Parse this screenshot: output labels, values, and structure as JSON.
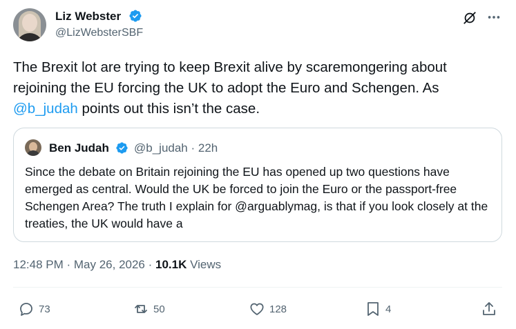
{
  "author": {
    "name": "Liz Webster",
    "handle": "@LizWebsterSBF"
  },
  "tweet": {
    "text_before": "The Brexit lot are trying to keep Brexit alive by scaremongering about rejoining the EU forcing the UK to adopt the Euro and Schengen. As ",
    "mention": "@b_judah",
    "text_after": " points out this isn’t the case."
  },
  "quoted": {
    "name": "Ben Judah",
    "meta": "@b_judah · 22h",
    "text": "Since the debate on Britain rejoining the EU has opened up two questions have emerged as central. Would the UK be forced to join the Euro or the passport-free Schengen Area?  The truth I explain for @arguablymag, is that if you look closely at the treaties, the UK would have a"
  },
  "meta": {
    "timestamp": "12:48 PM · May 26, 2026 · ",
    "views_count": "10.1K",
    "views_label": " Views"
  },
  "actions": {
    "replies": "73",
    "reposts": "50",
    "likes": "128",
    "bookmarks": "4"
  },
  "icons": [
    "verified-badge-icon",
    "grok-icon",
    "more-icon",
    "reply-icon",
    "repost-icon",
    "like-icon",
    "bookmark-icon",
    "share-icon"
  ],
  "colors": {
    "accent": "#1d9bf0",
    "text": "#0f1419",
    "secondary_text": "#536471",
    "border": "#cfd9de"
  }
}
